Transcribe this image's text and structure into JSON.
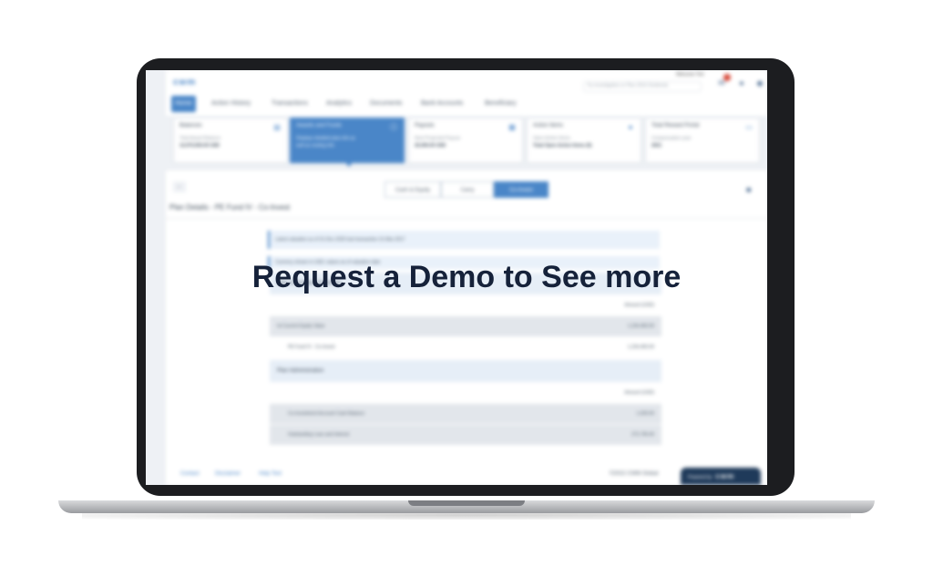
{
  "overlay": {
    "headline": "Request a Demo to See more"
  },
  "app": {
    "logo": "cwm",
    "user_name": "Welcome Ted",
    "search_placeholder": "Try investigation or Plan 2016 Dividends",
    "icons": [
      "mail-icon",
      "help-icon",
      "user-icon"
    ]
  },
  "tabs": [
    "Home",
    "Action History",
    "Transactions",
    "Analytics",
    "Documents",
    "Bank Accounts",
    "Beneficiary"
  ],
  "cards": [
    {
      "title": "Balances",
      "sub": "Total Award Balance",
      "value": "13,070,550.00 USD",
      "icon": "chart-icon"
    },
    {
      "title": "Awards and Funds",
      "sub": "Displays detailed plan info as",
      "value": "well as vesting info",
      "icon": "info-icon"
    },
    {
      "title": "Payouts",
      "sub": "Next Projected Payout",
      "value": "20,000.00 USD",
      "icon": "calendar-icon"
    },
    {
      "title": "Action Items",
      "sub": "Open Action Items",
      "value": "Total Open Action Items (5)",
      "icon": "globe-icon"
    },
    {
      "title": "Total Reward Portal",
      "sub": "Compensation year",
      "value": "2021",
      "icon": "monitor-icon"
    }
  ],
  "panel": {
    "segments": [
      "Cash & Equity",
      "Carry",
      "Co-Invest"
    ],
    "plan_title": "Plan Details - PE Fund IV - Co-Invest",
    "note": "Latest valuation as of 31-Dec-2020 last transaction 31-Mar-2017",
    "note2": "Currency shown in USD; values as of valuation date",
    "summary": {
      "heading": "Plan Investment Summary",
      "col": "Amount (USD)",
      "rows": [
        {
          "label": "Ivt Current Equity Value",
          "amount": "1,234,450.00"
        },
        {
          "label": "PE Fund IV - Co-Invest",
          "amount": "1,234,450.00"
        }
      ]
    },
    "admin": {
      "heading": "Plan Administration",
      "col": "Amount (USD)",
      "rows": [
        {
          "label": "Co-Investment Account Cash Balance",
          "amount": "1,025.00"
        },
        {
          "label": "Outstanding Loan and Interest",
          "amount": "272,745.40"
        }
      ]
    }
  },
  "footer": {
    "links": [
      "Contact",
      "Disclaimer",
      "Help Text"
    ],
    "copyright": "©2022 CWM Global",
    "powered_by": "Powered by",
    "powered_logo": "cwm"
  }
}
